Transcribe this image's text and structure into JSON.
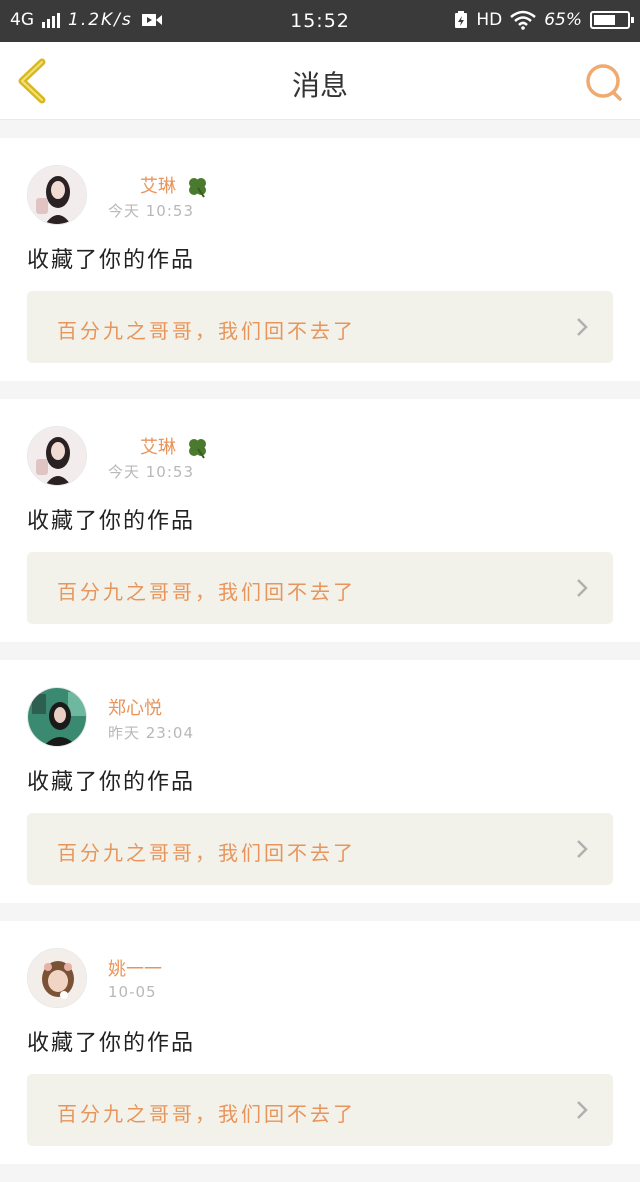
{
  "status_bar": {
    "network": "4G",
    "speed": "1.2K/s",
    "time": "15:52",
    "hd": "HD",
    "battery": "65%",
    "battery_level": 0.65
  },
  "nav": {
    "title": "消息",
    "back_icon": "chevron-left-icon",
    "search_icon": "search-icon",
    "accent_color": "#d8b820"
  },
  "messages": [
    {
      "user": "艾琳",
      "time": "今天 10:53",
      "action": "收藏了你的作品",
      "work_title": "百分九之哥哥，我们回不去了",
      "avatar": "avatar-1"
    },
    {
      "user": "艾琳",
      "time": "今天 10:53",
      "action": "收藏了你的作品",
      "work_title": "百分九之哥哥，我们回不去了",
      "avatar": "avatar-1"
    },
    {
      "user": "郑心悦",
      "time": "昨天 23:04",
      "action": "收藏了你的作品",
      "work_title": "百分九之哥哥，我们回不去了",
      "avatar": "avatar-2"
    },
    {
      "user": "姚一一",
      "time": "10-05",
      "action": "收藏了你的作品",
      "work_title": "百分九之哥哥，我们回不去了",
      "avatar": "avatar-3"
    }
  ],
  "colors": {
    "name_orange": "#e8955c",
    "link_bg": "#f2f2ea",
    "search_orange": "#f0a96e"
  }
}
